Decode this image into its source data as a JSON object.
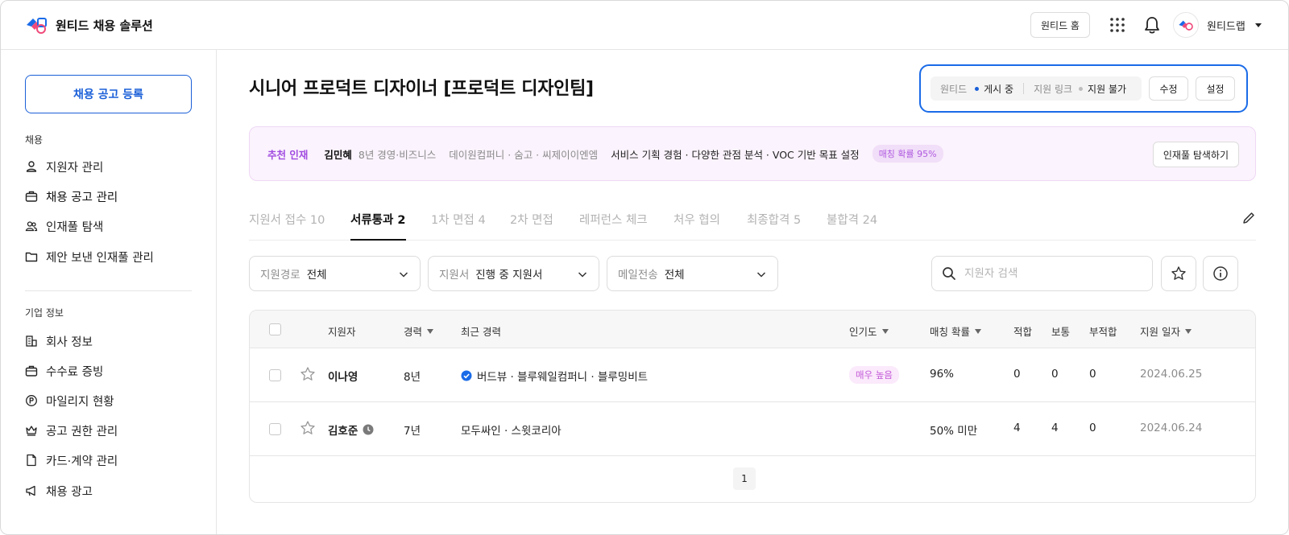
{
  "header": {
    "logo_text": "원티드 채용 솔루션",
    "home_button": "원티드 홈",
    "account_name": "원티드랩"
  },
  "sidebar": {
    "post_button": "채용 공고 등록",
    "section_recruit": "채용",
    "recruit_items": [
      {
        "label": "지원자 관리",
        "icon": "person-icon"
      },
      {
        "label": "채용 공고 관리",
        "icon": "briefcase-icon"
      },
      {
        "label": "인재풀 탐색",
        "icon": "people-icon"
      },
      {
        "label": "제안 보낸 인재풀 관리",
        "icon": "folder-icon"
      }
    ],
    "section_company": "기업 정보",
    "company_items": [
      {
        "label": "회사 정보",
        "icon": "building-icon"
      },
      {
        "label": "수수료 증빙",
        "icon": "briefcase-icon"
      },
      {
        "label": "마일리지 현황",
        "icon": "mileage-icon"
      },
      {
        "label": "공고 권한 관리",
        "icon": "crown-icon"
      },
      {
        "label": "카드·계약 관리",
        "icon": "document-icon"
      },
      {
        "label": "채용 광고",
        "icon": "megaphone-icon"
      }
    ]
  },
  "main": {
    "title": "시니어 프로덕트 디자이너 [프로덕트 디자인팀]",
    "status": {
      "wanted_label": "원티드",
      "wanted_state": "게시 중",
      "link_label": "지원 링크",
      "link_state": "지원 불가",
      "edit_button": "수정",
      "settings_button": "설정",
      "active_color": "#1a5fd8",
      "inactive_color": "#bdbdbd"
    },
    "recommend": {
      "tag": "추천 인재",
      "name": "김민혜",
      "career": "8년 경영·비즈니스",
      "companies": "데이원컴퍼니 · 숨고 · 씨제이이엔엠",
      "summary": "서비스 기획 경험 · 다양한 관점 분석 · VOC 기반 목표 설정",
      "match": "매칭 확률 95%",
      "explore_button": "인재풀 탐색하기"
    },
    "tabs": [
      {
        "label": "지원서 접수 10"
      },
      {
        "label": "서류통과 2"
      },
      {
        "label": "1차 면접 4"
      },
      {
        "label": "2차 면접"
      },
      {
        "label": "레퍼런스 체크"
      },
      {
        "label": "처우 협의"
      },
      {
        "label": "최종합격 5"
      },
      {
        "label": "불합격 24"
      }
    ],
    "active_tab": "서류통과 2",
    "filters": [
      {
        "label": "지원경로",
        "value": "전체"
      },
      {
        "label": "지원서",
        "value": "진행 중 지원서"
      },
      {
        "label": "메일전송",
        "value": "전체"
      }
    ],
    "search_placeholder": "지원자 검색",
    "table": {
      "columns": {
        "applicant": "지원자",
        "career": "경력",
        "recent": "최근 경력",
        "popularity": "인기도",
        "match": "매칭 확률",
        "fit": "적합",
        "normal": "보통",
        "unfit": "부적합",
        "date": "지원 일자"
      },
      "rows": [
        {
          "name": "이나영",
          "career": "8년",
          "recent": "버드뷰 · 블루웨일컴퍼니 · 블루밍비트",
          "verified": true,
          "popularity": "매우 높음",
          "match": "96%",
          "fit": "0",
          "normal": "0",
          "unfit": "0",
          "date": "2024.06.25"
        },
        {
          "name": "김호준",
          "career": "7년",
          "recent": "모두싸인 · 스윗코리아",
          "verified": false,
          "popularity": "",
          "match": "50% 미만",
          "fit": "4",
          "normal": "4",
          "unfit": "0",
          "date": "2024.06.24"
        }
      ],
      "page": "1"
    }
  }
}
